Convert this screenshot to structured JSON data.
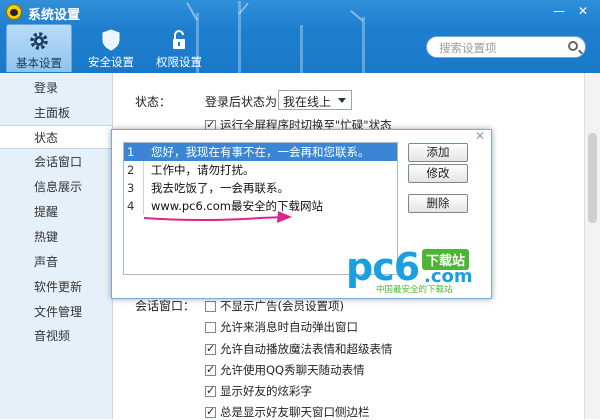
{
  "window": {
    "title": "系统设置",
    "minimize": "—",
    "close": "✕"
  },
  "top_tabs": [
    {
      "label": "基本设置",
      "icon": "gear-icon",
      "active": true
    },
    {
      "label": "安全设置",
      "icon": "shield-icon",
      "active": false
    },
    {
      "label": "权限设置",
      "icon": "lock-icon",
      "active": false
    }
  ],
  "search": {
    "placeholder": "搜索设置项"
  },
  "sidebar": {
    "items": [
      {
        "label": "登录",
        "active": false
      },
      {
        "label": "主面板",
        "active": false
      },
      {
        "label": "状态",
        "active": true
      },
      {
        "label": "会话窗口",
        "active": false
      },
      {
        "label": "信息展示",
        "active": false
      },
      {
        "label": "提醒",
        "active": false
      },
      {
        "label": "热键",
        "active": false
      },
      {
        "label": "声音",
        "active": false
      },
      {
        "label": "软件更新",
        "active": false
      },
      {
        "label": "文件管理",
        "active": false
      },
      {
        "label": "音视频",
        "active": false
      }
    ]
  },
  "status_section": {
    "label": "状态：",
    "login_status_label": "登录后状态为:",
    "login_status_value": "我在线上",
    "fullscreen_option": "运行全屏程序时切换至\"忙碌\"状态"
  },
  "session_section": {
    "label": "会话窗口：",
    "options": [
      {
        "label": "不显示广告(会员设置项)",
        "checked": false
      },
      {
        "label": "允许来消息时自动弹出窗口",
        "checked": false
      },
      {
        "label": "允许自动播放魔法表情和超级表情",
        "checked": true
      },
      {
        "label": "允许使用QQ秀聊天随动表情",
        "checked": true
      },
      {
        "label": "显示好友的炫彩字",
        "checked": true
      },
      {
        "label": "总是显示好友聊天窗口侧边栏",
        "checked": true
      }
    ]
  },
  "dialog": {
    "close": "✕",
    "replies": [
      {
        "num": "1",
        "text": "您好，我现在有事不在，一会再和您联系。",
        "selected": true
      },
      {
        "num": "2",
        "text": "工作中，请勿打扰。",
        "selected": false
      },
      {
        "num": "3",
        "text": "我去吃饭了，一会再联系。",
        "selected": false
      },
      {
        "num": "4",
        "text": "www.pc6.com最安全的下载网站",
        "selected": false
      }
    ],
    "add_label": "添加",
    "modify_label": "修改",
    "delete_label": "删除"
  },
  "watermark": {
    "brand": "pc6",
    "badge": "下载站",
    "domain": ".com",
    "slogan": "中国最安全的下载站"
  },
  "colors": {
    "header": "#1f7fcf",
    "selection": "#3a86d4",
    "annotation": "#e0248a",
    "brand_blue": "#1aa0e0",
    "brand_green": "#4eb534"
  }
}
